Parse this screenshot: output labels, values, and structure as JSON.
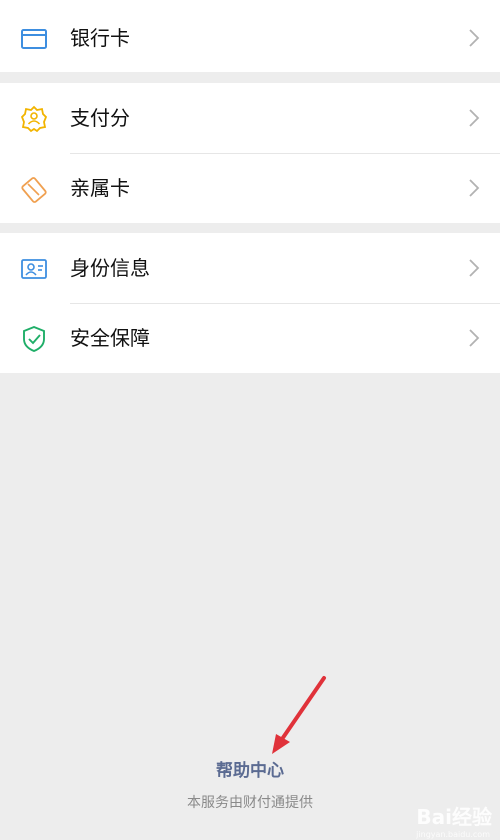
{
  "menu": {
    "group1": [
      {
        "label": "银行卡",
        "icon": "bank-card-icon"
      }
    ],
    "group2": [
      {
        "label": "支付分",
        "icon": "payment-score-icon"
      },
      {
        "label": "亲属卡",
        "icon": "family-card-icon"
      }
    ],
    "group3": [
      {
        "label": "身份信息",
        "icon": "identity-card-icon"
      },
      {
        "label": "安全保障",
        "icon": "security-shield-icon"
      }
    ]
  },
  "footer": {
    "help_label": "帮助中心",
    "provider_text": "本服务由财付通提供"
  },
  "watermark": {
    "text": "Bai经验",
    "sub": "jingyan.baidu.com"
  },
  "colors": {
    "background": "#ededed",
    "bank_icon": "#3d8ee0",
    "score_icon": "#f2b400",
    "family_icon": "#f0a050",
    "identity_icon": "#3d8ee0",
    "security_icon": "#1fae68",
    "help_link": "#5b6b92",
    "arrow": "#e0323a"
  }
}
